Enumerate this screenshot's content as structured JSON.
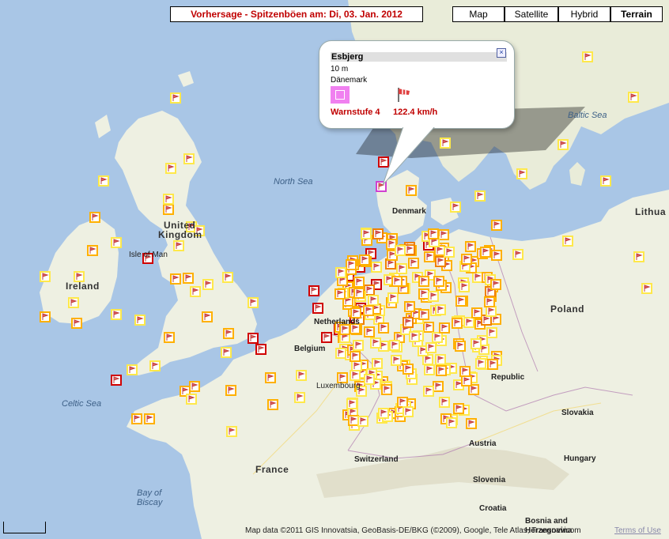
{
  "header": {
    "title": "Vorhersage - Spitzenböen am: Di, 03. Jan. 2012"
  },
  "map_types": [
    {
      "label": "Map",
      "active": false
    },
    {
      "label": "Satellite",
      "active": false
    },
    {
      "label": "Hybrid",
      "active": false
    },
    {
      "label": "Terrain",
      "active": true
    }
  ],
  "labels": {
    "north_sea": "North Sea",
    "baltic_sea": "Baltic Sea",
    "celtic_sea": "Celtic Sea",
    "bay_of_biscay_1": "Bay of",
    "bay_of_biscay_2": "Biscay",
    "uk_1": "United",
    "uk_2": "Kingdom",
    "isle_of_man": "Isle of Man",
    "ireland": "Ireland",
    "denmark": "Denmark",
    "netherlands": "Netherlands",
    "belgium": "Belgium",
    "luxembourg": "Luxembourg",
    "france": "France",
    "switzerland": "Switzerland",
    "austria": "Austria",
    "slovenia": "Slovenia",
    "croatia": "Croatia",
    "bosnia_1": "Bosnia and",
    "bosnia_2": "Herzegovina",
    "hungary": "Hungary",
    "slovakia": "Slovakia",
    "czech": "Republic",
    "poland": "Poland",
    "lithuania": "Lithua"
  },
  "popup": {
    "station": "Esbjerg",
    "elevation": "10 m",
    "country": "Dänemark",
    "warning": "Warnstufe 4",
    "speed": "122.4  km/h",
    "close_icon": "close-icon",
    "windsock_icon": "windsock-icon"
  },
  "footer": {
    "attribution": "Map data ©2011 GIS Innovatsia, GeoBasis-DE/BKG (©2009), Google, Tele Atlas, Transnavicom",
    "terms": "Terms of Use"
  },
  "colors": {
    "level_1": "#ffe84a",
    "level_2": "#ffb000",
    "level_3": "#f08000",
    "level_4": "#d00000",
    "selected": "#d040d0",
    "title_text": "#c00000",
    "sea": "#a9c6e6",
    "land": "#eef0e2"
  }
}
